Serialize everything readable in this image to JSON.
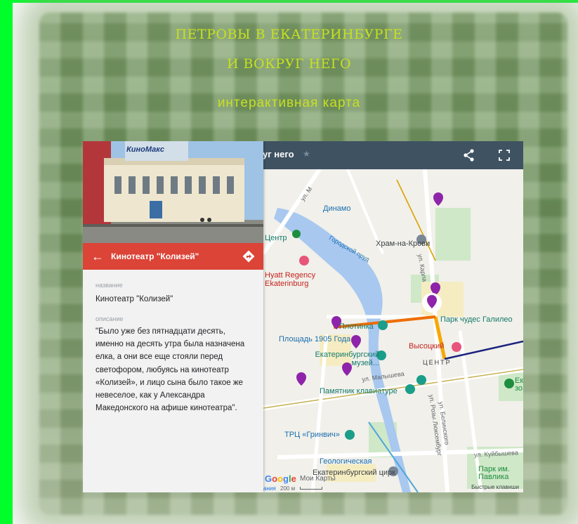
{
  "header": {
    "title_line1": "ПЕТРОВЫ В ЕКАТЕРИНБУРГЕ",
    "title_line2": "И ВОКРУГ НЕГО",
    "subtitle": "интерактивная карта"
  },
  "map_toolbar": {
    "title": "уг него",
    "share_icon": "share-icon",
    "fullscreen_icon": "fullscreen-icon"
  },
  "place_panel": {
    "photo_sign": "КиноМакс",
    "name": "Кинотеатр \"Колизей\"",
    "fields": [
      {
        "label": "название",
        "value": "Кинотеатр \"Колизей\""
      },
      {
        "label": "описание",
        "value": "\"Было уже без пятнадцати десять, именно на десять утра была назначена елка, а они все еще стояли перед светофором, любуясь на кинотеатр «Колизей», и лицо сына было такое же невеселое, как у Александра Македонского на афише кинотеатра\"."
      }
    ]
  },
  "map": {
    "labels": {
      "dinamo": "Динамо",
      "khram": "Храм-на-Крови",
      "center": "Центр",
      "pond": "Городской пруд",
      "hyatt": "Hyatt Regency Ekaterinburg",
      "plotinka": "Плотинка",
      "galileo": "Парк чудес Галилео",
      "square": "Площадь 1905 Года",
      "museum": "Екатеринбургский музей...",
      "vysotsky": "Высоцкий",
      "district": "ЦЕНТР",
      "keyboard": "Памятник клавиатуре",
      "grinvich": "ТРЦ «Гринвич»",
      "geo": "Геологическая",
      "circus": "Екатеринбургский цирк",
      "park": "Парк им. Павлика",
      "zoo": "Ек зо",
      "street_malysheva": "ул. Малышева",
      "street_belinskogo": "ул. Белинского",
      "street_luxemburg": "ул. Розы Люксембург",
      "street_kuibysheva": "ул. Куйбышева",
      "street_karla": "ул. Карла",
      "street_m": "ул. М"
    },
    "google": "Google",
    "my_maps": "Мои Карты",
    "data_label": "ания",
    "scale": "200 м",
    "shortcuts": "Быстрые клавиши"
  },
  "colors": {
    "toolbar": "#3e5262",
    "place_bar": "#db4437",
    "marker": "#8e24aa",
    "title_yellow": "#c7e020",
    "frame_green": "#00ff2a"
  }
}
